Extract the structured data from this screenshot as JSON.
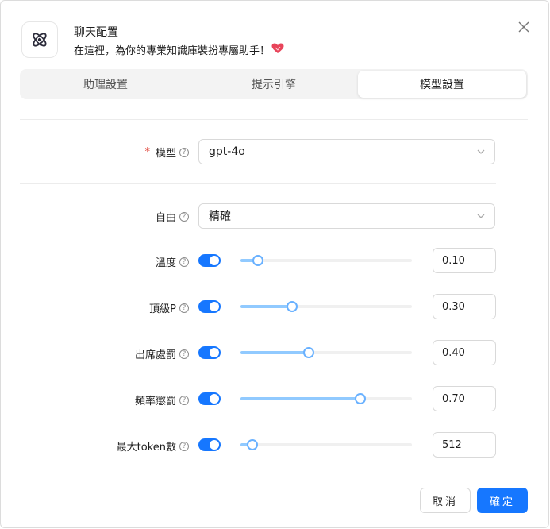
{
  "header": {
    "title": "聊天配置",
    "subtitle": "在這裡，為你的專業知識庫裝扮專屬助手！"
  },
  "tabs": [
    {
      "label": "助理設置",
      "active": false
    },
    {
      "label": "提示引擎",
      "active": false
    },
    {
      "label": "模型設置",
      "active": true
    }
  ],
  "model": {
    "label": "模型",
    "value": "gpt-4o"
  },
  "freedom": {
    "label": "自由",
    "value": "精確"
  },
  "params": [
    {
      "label": "溫度",
      "enabled": true,
      "level": 0.1,
      "value": "0.10"
    },
    {
      "label": "頂級P",
      "enabled": true,
      "level": 0.3,
      "value": "0.30"
    },
    {
      "label": "出席處罰",
      "enabled": true,
      "level": 0.4,
      "value": "0.40"
    },
    {
      "label": "頻率懲罰",
      "enabled": true,
      "level": 0.7,
      "value": "0.70"
    },
    {
      "label": "最大token數",
      "enabled": true,
      "level": 0.07,
      "value": "512"
    }
  ],
  "footer": {
    "cancel_label": "取消",
    "ok_label": "確定"
  },
  "colors": {
    "accent": "#1677ff",
    "slider_fill": "#91caff",
    "required": "#e0453a"
  }
}
